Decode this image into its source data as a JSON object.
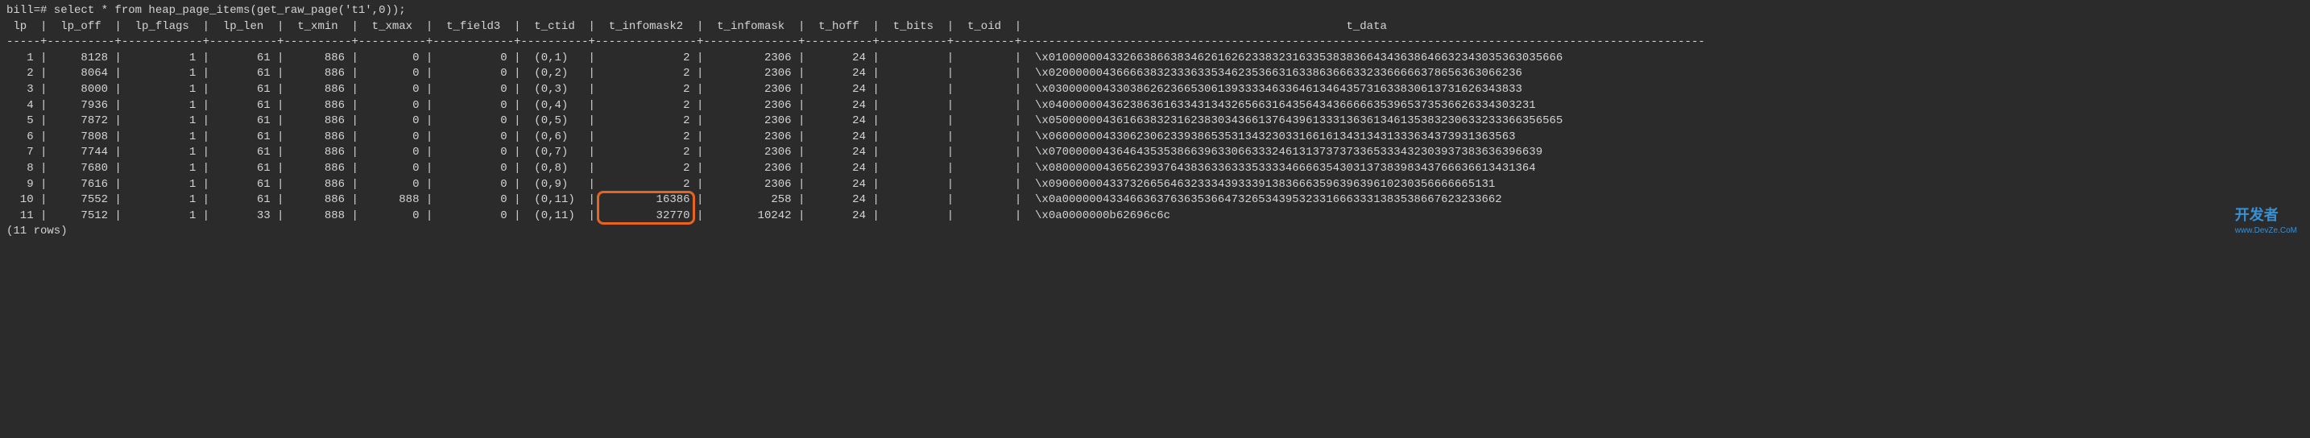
{
  "prompt": "bill=# select * from heap_page_items(get_raw_page('t1',0));",
  "columns": [
    "lp",
    "lp_off",
    "lp_flags",
    "lp_len",
    "t_xmin",
    "t_xmax",
    "t_field3",
    "t_ctid",
    "t_infomask2",
    "t_infomask",
    "t_hoff",
    "t_bits",
    "t_oid",
    "t_data"
  ],
  "rows": [
    {
      "lp": "1",
      "lp_off": "8128",
      "lp_flags": "1",
      "lp_len": "61",
      "t_xmin": "886",
      "t_xmax": "0",
      "t_field3": "0",
      "t_ctid": "(0,1)",
      "t_infomask2": "2",
      "t_infomask": "2306",
      "t_hoff": "24",
      "t_bits": "",
      "t_oid": "",
      "t_data": "\\x0100000043326638663834626162623383231633538383664343638646632343035363035666"
    },
    {
      "lp": "2",
      "lp_off": "8064",
      "lp_flags": "1",
      "lp_len": "61",
      "t_xmin": "886",
      "t_xmax": "0",
      "t_field3": "0",
      "t_ctid": "(0,2)",
      "t_infomask2": "2",
      "t_infomask": "2306",
      "t_hoff": "24",
      "t_bits": "",
      "t_oid": "",
      "t_data": "\\x0200000043666638323336335346235366316338636663323366666378656363066236"
    },
    {
      "lp": "3",
      "lp_off": "8000",
      "lp_flags": "1",
      "lp_len": "61",
      "t_xmin": "886",
      "t_xmax": "0",
      "t_field3": "0",
      "t_ctid": "(0,3)",
      "t_infomask2": "2",
      "t_infomask": "2306",
      "t_hoff": "24",
      "t_bits": "",
      "t_oid": "",
      "t_data": "\\x0300000043303862623665306139333346336461346435731633830613731626343833"
    },
    {
      "lp": "4",
      "lp_off": "7936",
      "lp_flags": "1",
      "lp_len": "61",
      "t_xmin": "886",
      "t_xmax": "0",
      "t_field3": "0",
      "t_ctid": "(0,4)",
      "t_infomask2": "2",
      "t_infomask": "2306",
      "t_hoff": "24",
      "t_bits": "",
      "t_oid": "",
      "t_data": "\\x040000004362386361633431343265663164356434366666353965373536626334303231"
    },
    {
      "lp": "5",
      "lp_off": "7872",
      "lp_flags": "1",
      "lp_len": "61",
      "t_xmin": "886",
      "t_xmax": "0",
      "t_field3": "0",
      "t_ctid": "(0,5)",
      "t_infomask2": "2",
      "t_infomask": "2306",
      "t_hoff": "24",
      "t_bits": "",
      "t_oid": "",
      "t_data": "\\x0500000043616638323162383034366137643961333136361346135383230633233366356565"
    },
    {
      "lp": "6",
      "lp_off": "7808",
      "lp_flags": "1",
      "lp_len": "61",
      "t_xmin": "886",
      "t_xmax": "0",
      "t_field3": "0",
      "t_ctid": "(0,6)",
      "t_infomask2": "2",
      "t_infomask": "2306",
      "t_hoff": "24",
      "t_bits": "",
      "t_oid": "",
      "t_data": "\\x060000004330623062339386535313432303316616134313431333634373931363563"
    },
    {
      "lp": "7",
      "lp_off": "7744",
      "lp_flags": "1",
      "lp_len": "61",
      "t_xmin": "886",
      "t_xmax": "0",
      "t_field3": "0",
      "t_ctid": "(0,7)",
      "t_infomask2": "2",
      "t_infomask": "2306",
      "t_hoff": "24",
      "t_bits": "",
      "t_oid": "",
      "t_data": "\\x0700000043646435353866396330663332461313737373365333432303937383636396639"
    },
    {
      "lp": "8",
      "lp_off": "7680",
      "lp_flags": "1",
      "lp_len": "61",
      "t_xmin": "886",
      "t_xmax": "0",
      "t_field3": "0",
      "t_ctid": "(0,8)",
      "t_infomask2": "2",
      "t_infomask": "2306",
      "t_hoff": "24",
      "t_bits": "",
      "t_oid": "",
      "t_data": "\\x080000004365623937643836336333533334666635430313738398343766636613431364"
    },
    {
      "lp": "9",
      "lp_off": "7616",
      "lp_flags": "1",
      "lp_len": "61",
      "t_xmin": "886",
      "t_xmax": "0",
      "t_field3": "0",
      "t_ctid": "(0,9)",
      "t_infomask2": "2",
      "t_infomask": "2306",
      "t_hoff": "24",
      "t_bits": "",
      "t_oid": "",
      "t_data": "\\x090000004337326656463233343933391383666359639639610230356666665131"
    },
    {
      "lp": "10",
      "lp_off": "7552",
      "lp_flags": "1",
      "lp_len": "61",
      "t_xmin": "886",
      "t_xmax": "888",
      "t_field3": "0",
      "t_ctid": "(0,11)",
      "t_infomask2": "16386",
      "t_infomask": "258",
      "t_hoff": "24",
      "t_bits": "",
      "t_oid": "",
      "t_data": "\\x0a00000043346636376363536647326534395323316663331383538667623233662"
    },
    {
      "lp": "11",
      "lp_off": "7512",
      "lp_flags": "1",
      "lp_len": "33",
      "t_xmin": "888",
      "t_xmax": "0",
      "t_field3": "0",
      "t_ctid": "(0,11)",
      "t_infomask2": "32770",
      "t_infomask": "10242",
      "t_hoff": "24",
      "t_bits": "",
      "t_oid": "",
      "t_data": "\\x0a0000000b62696c6c"
    }
  ],
  "footer": "(11 rows)",
  "highlight": {
    "rows": [
      9,
      10
    ],
    "column": "t_infomask2"
  },
  "watermark": {
    "brand": "开发者",
    "site": "www.DevZe.CoM"
  },
  "widths": {
    "lp": 4,
    "lp_off": 8,
    "lp_flags": 10,
    "lp_len": 8,
    "t_xmin": 8,
    "t_xmax": 8,
    "t_field3": 10,
    "t_ctid": 8,
    "t_infomask2": 13,
    "t_infomask": 12,
    "t_hoff": 8,
    "t_bits": 8,
    "t_oid": 7,
    "t_data": 100
  },
  "separator_char": "-"
}
